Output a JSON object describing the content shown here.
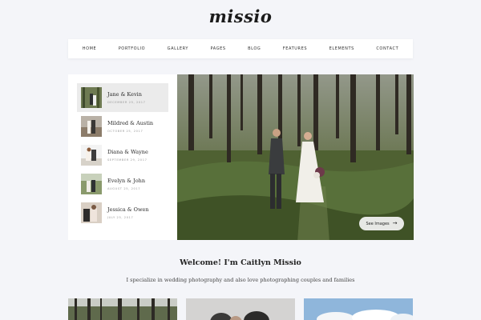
{
  "site": {
    "logo": "missio"
  },
  "nav": [
    "HOME",
    "PORTFOLIO",
    "GALLERY",
    "PAGES",
    "BLOG",
    "FEATURES",
    "ELEMENTS",
    "CONTACT"
  ],
  "posts": [
    {
      "name": "Jane & Kevin",
      "date": "DECEMBER 25, 2017",
      "active": true
    },
    {
      "name": "Mildred & Austin",
      "date": "OCTOBER 25, 2017",
      "active": false
    },
    {
      "name": "Diana & Wayne",
      "date": "SEPTEMBER 29, 2017",
      "active": false
    },
    {
      "name": "Evelyn & John",
      "date": "AUGUST 25, 2017",
      "active": false
    },
    {
      "name": "Jessica & Owen",
      "date": "JULY 25, 2017",
      "active": false
    }
  ],
  "hero": {
    "button_label": "See Images",
    "button_icon": "arrow-right-icon"
  },
  "welcome": {
    "title": "Welcome! I'm Caitlyn Missio",
    "text": "I specialize in wedding photography and also love photographing couples and families"
  },
  "colors": {
    "background": "#f4f5f9",
    "card": "#ffffff",
    "forest": "#4d5f33",
    "text": "#222222"
  }
}
